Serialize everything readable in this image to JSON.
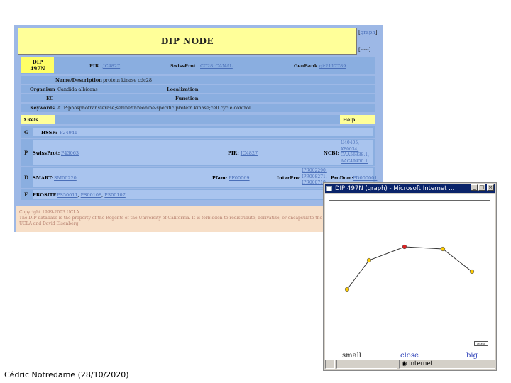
{
  "main": {
    "header": {
      "title": "DIP NODE",
      "graph_link": "graph",
      "dashes": "[-----]"
    },
    "node": {
      "dip_id_line1": "DIP",
      "dip_id_line2": "497N",
      "pir_label": "PIR",
      "pir_value": "JC4827",
      "swissprot_label": "SwissProt",
      "swissprot_value": "CC28_CANAL",
      "genbank_label": "GenBank",
      "genbank_value": "gi:2117789",
      "name_label": "Name/Description",
      "name_value": "protein kinase cdc28",
      "organism_label": "Organism",
      "organism_value": "Candida albicans",
      "localization_label": "Localization",
      "ec_label": "EC",
      "function_label": "Function",
      "keywords_label": "Keywords",
      "keywords_value": "ATP;phosphotransferase;serine/threonine-specific protein kinase;cell cycle control"
    },
    "xrefs": {
      "title": "XRefs",
      "help": "Help",
      "g_letter": "G",
      "hssp_label": "HSSP:",
      "hssp_value": "P24941",
      "p_letter": "P",
      "p_swissprot_label": "SwissProt:",
      "p_swissprot_value": "P43063",
      "p_pir_label": "PIR:",
      "p_pir_value": "JC4827",
      "ncbi_label": "NCBI:",
      "ncbi_values": [
        "U40405,",
        "X80034,",
        "CAA56338.1,",
        "AAC49450.1"
      ],
      "d_letter": "D",
      "smart_label": "SMART:",
      "smart_value": "SM00220",
      "pfam_label": "Pfam:",
      "pfam_value": "PF00069",
      "interpro_label": "InterPro:",
      "interpro_values": [
        "IPR002290,",
        "IPR008271,",
        "IPR000719"
      ],
      "prodom_label": "ProDom:",
      "prodom_value": "PD000001",
      "f_letter": "F",
      "prosite_label": "PROSITE:",
      "prosite_values": [
        "PS50011",
        "PS00108",
        "PS00107"
      ]
    },
    "footer": {
      "copyright": "Copyright 1999-2003 UCLA",
      "text": "The DIP database is the property of the Regents of the University of California. It is forbidden to redistribute, derivatize, or encapsulate the without permission from UCLA and David Eisenberg."
    }
  },
  "popup": {
    "title": "DIP:497N (graph) - Microsoft Internet ...",
    "buttons": {
      "minimize": "_",
      "maximize": "□",
      "close": "×"
    },
    "legend_label": "LEGEND",
    "size_links": {
      "small": "small",
      "close": "close",
      "big": "big"
    },
    "status_text": "Internet",
    "graph": {
      "nodes": [
        {
          "color": "#ffcc00"
        },
        {
          "color": "#ffcc00"
        },
        {
          "color": "#dd2222"
        },
        {
          "color": "#ffcc00"
        },
        {
          "color": "#ffcc00"
        }
      ]
    }
  },
  "credit": "Cédric Notredame (28/10/2020)"
}
